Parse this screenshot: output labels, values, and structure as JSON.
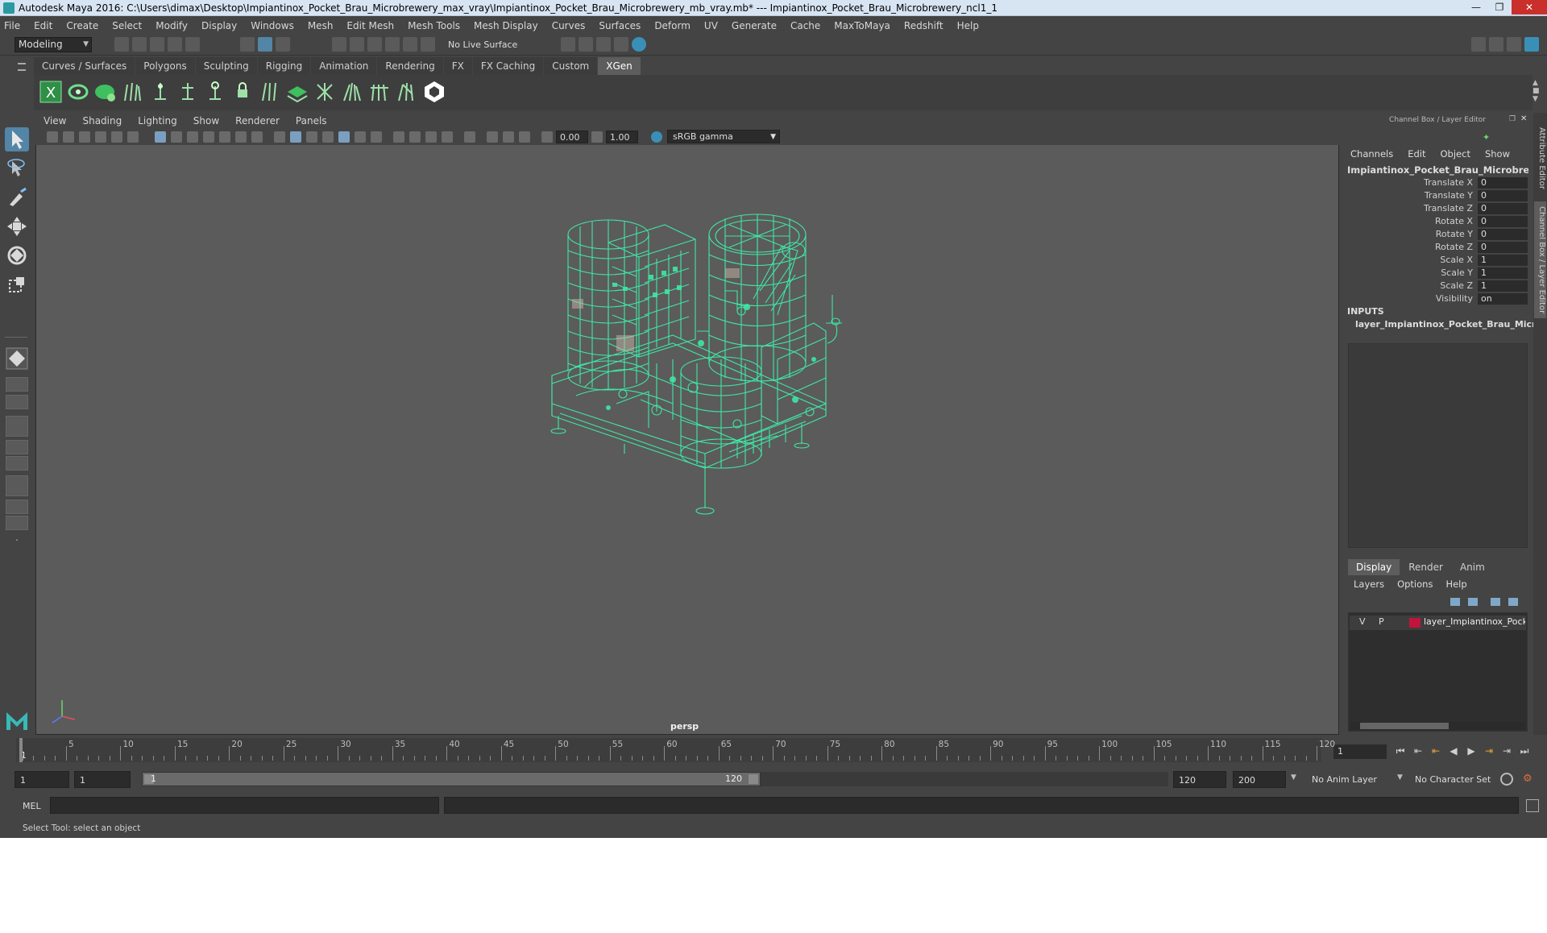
{
  "window": {
    "title": "Autodesk Maya 2016: C:\\Users\\dimax\\Desktop\\Impiantinox_Pocket_Brau_Microbrewery_max_vray\\Impiantinox_Pocket_Brau_Microbrewery_mb_vray.mb*   ---   Impiantinox_Pocket_Brau_Microbrewery_ncl1_1",
    "minimize": "—",
    "maximize": "❐",
    "close": "✕"
  },
  "menubar": [
    "File",
    "Edit",
    "Create",
    "Select",
    "Modify",
    "Display",
    "Windows",
    "Mesh",
    "Edit Mesh",
    "Mesh Tools",
    "Mesh Display",
    "Curves",
    "Surfaces",
    "Deform",
    "UV",
    "Generate",
    "Cache",
    "MaxToMaya",
    "Redshift",
    "Help"
  ],
  "statusline": {
    "mode": "Modeling",
    "live_surface": "No Live Surface"
  },
  "shelf": {
    "tabs": [
      "Curves / Surfaces",
      "Polygons",
      "Sculpting",
      "Rigging",
      "Animation",
      "Rendering",
      "FX",
      "FX Caching",
      "Custom",
      "XGen"
    ],
    "active_tab": "XGen"
  },
  "viewport": {
    "menu": [
      "View",
      "Shading",
      "Lighting",
      "Show",
      "Renderer",
      "Panels"
    ],
    "exposure": "0.00",
    "gamma_value": "1.00",
    "color_space": "sRGB gamma",
    "camera": "persp"
  },
  "channel_box": {
    "title": "Channel Box / Layer Editor",
    "menu": [
      "Channels",
      "Edit",
      "Object",
      "Show"
    ],
    "object_name": "Impiantinox_Pocket_Brau_Microbrewery...",
    "attributes": [
      {
        "name": "Translate X",
        "value": "0"
      },
      {
        "name": "Translate Y",
        "value": "0"
      },
      {
        "name": "Translate Z",
        "value": "0"
      },
      {
        "name": "Rotate X",
        "value": "0"
      },
      {
        "name": "Rotate Y",
        "value": "0"
      },
      {
        "name": "Rotate Z",
        "value": "0"
      },
      {
        "name": "Scale X",
        "value": "1"
      },
      {
        "name": "Scale Y",
        "value": "1"
      },
      {
        "name": "Scale Z",
        "value": "1"
      },
      {
        "name": "Visibility",
        "value": "on"
      }
    ],
    "inputs_title": "INPUTS",
    "inputs_item": "layer_Impiantinox_Pocket_Brau_Micro..."
  },
  "layer_editor": {
    "tabs": [
      "Display",
      "Render",
      "Anim"
    ],
    "active_tab": "Display",
    "menu": [
      "Layers",
      "Options",
      "Help"
    ],
    "layer": {
      "v": "V",
      "p": "P",
      "name": "layer_Impiantinox_Pocke",
      "color": "#c0143c"
    }
  },
  "side_tabs": [
    "Attribute Editor",
    "Channel Box / Layer Editor"
  ],
  "timeline": {
    "ticks": [
      "5",
      "10",
      "15",
      "20",
      "25",
      "30",
      "35",
      "40",
      "45",
      "50",
      "55",
      "60",
      "65",
      "70",
      "75",
      "80",
      "85",
      "90",
      "95",
      "100",
      "105",
      "110",
      "115",
      "120"
    ],
    "start_label": "1",
    "current_frame": "1",
    "start_min": "1",
    "start_current": "1",
    "range_start": "1",
    "range_end": "120",
    "end_current": "120",
    "end_max": "200",
    "anim_layer": "No Anim Layer",
    "character_set": "No Character Set"
  },
  "command_line": {
    "label": "MEL",
    "help": "Select Tool: select an object"
  },
  "colors": {
    "wireframe": "#3fe6a4",
    "active_tool": "#5285a6",
    "viewport_bg": "#5b5b5b"
  }
}
